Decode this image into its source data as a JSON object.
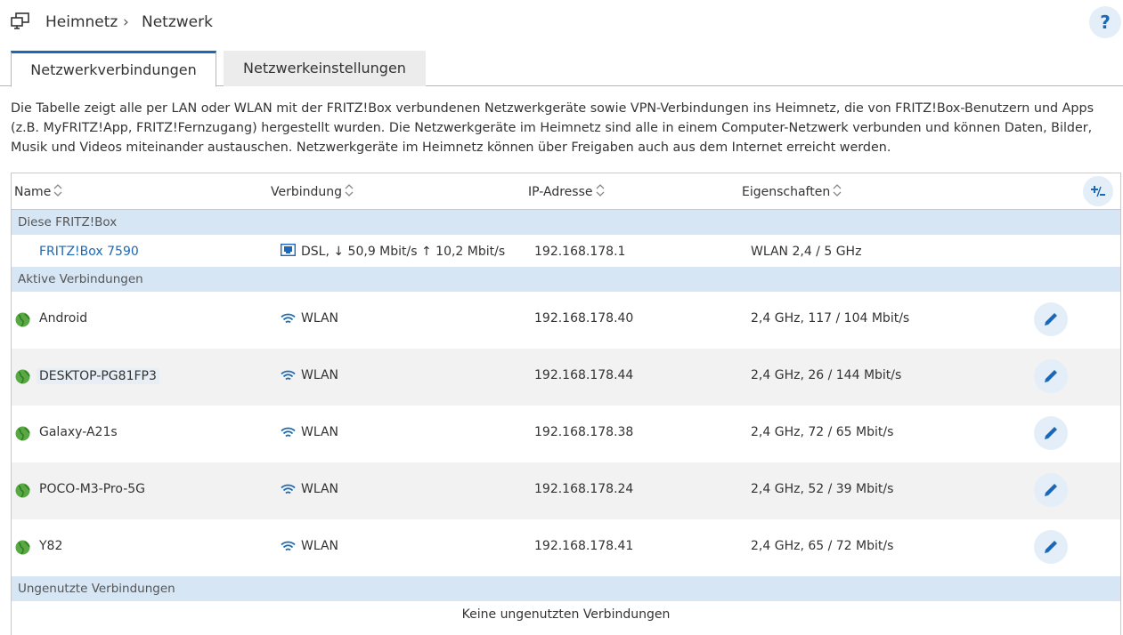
{
  "breadcrumb": {
    "home_icon": "network-home-icon",
    "item1": "Heimnetz",
    "separator": "›",
    "item2": "Netzwerk"
  },
  "help": {
    "label": "?"
  },
  "tabs": [
    {
      "label": "Netzwerkverbindungen",
      "active": true
    },
    {
      "label": "Netzwerkeinstellungen",
      "active": false
    }
  ],
  "description": "Die Tabelle zeigt alle per LAN oder WLAN mit der FRITZ!Box verbundenen Netzwerkgeräte sowie VPN-Verbindungen ins Heimnetz, die von FRITZ!Box-Benutzern und Apps (z.B. MyFRITZ!App, FRITZ!Fernzugang) hergestellt wurden. Die Netzwerkgeräte im Heimnetz sind alle in einem Computer-Netzwerk verbunden und können Daten, Bilder, Musik und Videos miteinander austauschen. Netzwerkgeräte im Heimnetz können über Freigaben auch aus dem Internet erreicht werden.",
  "table": {
    "headers": {
      "name": "Name",
      "connection": "Verbindung",
      "ip": "IP-Adresse",
      "properties": "Eigenschaften"
    },
    "column_toggle": "+∕−",
    "groups": {
      "this_box": "Diese FRITZ!Box",
      "active": "Aktive Verbindungen",
      "unused": "Ungenutzte Verbindungen"
    },
    "box_row": {
      "name": "FRITZ!Box 7590",
      "connection": "DSL, ↓ 50,9 Mbit/s ↑ 10,2 Mbit/s",
      "ip": "192.168.178.1",
      "properties": "WLAN 2,4 / 5 GHz"
    },
    "active_rows": [
      {
        "name": "Android",
        "connection": "WLAN",
        "ip": "192.168.178.40",
        "properties": "2,4 GHz, 117 / 104 Mbit/s"
      },
      {
        "name": "DESKTOP-PG81FP3",
        "connection": "WLAN",
        "ip": "192.168.178.44",
        "properties": "2,4 GHz, 26 / 144 Mbit/s"
      },
      {
        "name": "Galaxy-A21s",
        "connection": "WLAN",
        "ip": "192.168.178.38",
        "properties": "2,4 GHz, 72 / 65 Mbit/s"
      },
      {
        "name": "POCO-M3-Pro-5G",
        "connection": "WLAN",
        "ip": "192.168.178.24",
        "properties": "2,4 GHz, 52 / 39 Mbit/s"
      },
      {
        "name": "Y82",
        "connection": "WLAN",
        "ip": "192.168.178.41",
        "properties": "2,4 GHz, 65 / 72 Mbit/s"
      }
    ],
    "unused_empty": "Keine ungenutzten Verbindungen"
  },
  "colors": {
    "accent": "#1c68b4",
    "group_bg": "#d6e6f5",
    "button_bg": "#e3eef8",
    "globe": "#5aa845"
  }
}
